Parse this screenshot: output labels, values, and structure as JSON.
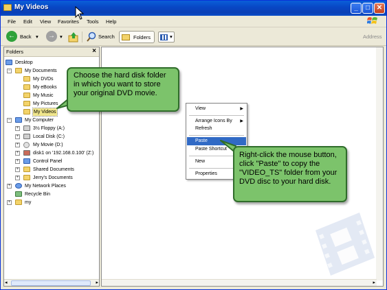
{
  "window": {
    "title": "My Videos"
  },
  "menubar": [
    "File",
    "Edit",
    "View",
    "Favorites",
    "Tools",
    "Help"
  ],
  "toolbar": {
    "back_label": "Back",
    "search_label": "Search",
    "folders_label": "Folders",
    "address_label": "Address"
  },
  "folders_pane": {
    "title": "Folders",
    "items": [
      {
        "label": "Desktop"
      },
      {
        "label": "My Documents"
      },
      {
        "label": "My DVDs"
      },
      {
        "label": "My eBooks"
      },
      {
        "label": "My Music"
      },
      {
        "label": "My Pictures"
      },
      {
        "label": "My Videos"
      },
      {
        "label": "My Computer"
      },
      {
        "label": "3½ Floppy (A:)"
      },
      {
        "label": "Local Disk (C:)"
      },
      {
        "label": "My Movie (D:)"
      },
      {
        "label": "disk1 on '192.168.0.100' (Z:)"
      },
      {
        "label": "Control Panel"
      },
      {
        "label": "Shared Documents"
      },
      {
        "label": "Jerry's Documents"
      },
      {
        "label": "My Network Places"
      },
      {
        "label": "Recycle Bin"
      },
      {
        "label": "my"
      }
    ]
  },
  "context_menu": {
    "view": "View",
    "arrange": "Arrange Icons By",
    "refresh": "Refresh",
    "paste": "Paste",
    "paste_shortcut": "Paste Shortcut",
    "new": "New",
    "properties": "Properties"
  },
  "callouts": {
    "folder_tip": "Choose the hard disk folder in which you want to store your original DVD movie.",
    "paste_tip": "Right-click the mouse button, click \"Paste\" to copy the \"VIDEO_TS\" folder from your DVD disc to your hard disk."
  },
  "colors": {
    "titlebar": "#0a4ec8",
    "callout": "#7cc36b",
    "highlight": "#316ac5"
  }
}
